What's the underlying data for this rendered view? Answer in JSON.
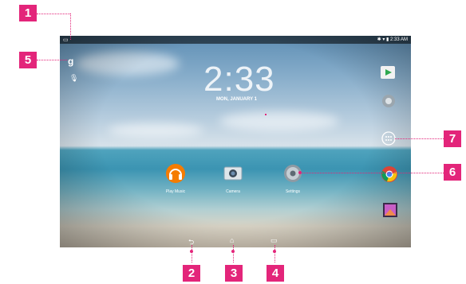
{
  "status_bar": {
    "time": "2:33 AM"
  },
  "lock": {
    "clock": "2:33",
    "date": "MON, JANUARY 1"
  },
  "apps": [
    {
      "label": "Play Music"
    },
    {
      "label": "Camera"
    },
    {
      "label": "Settings"
    }
  ],
  "callouts": [
    "1",
    "2",
    "3",
    "4",
    "5",
    "6",
    "7"
  ],
  "icons": {
    "search": "g-icon",
    "voice": "mic-icon",
    "play_store": "play-store-icon",
    "settings_right": "gear-icon",
    "app_drawer": "apps-grid-icon",
    "chrome": "chrome-icon",
    "gallery": "gallery-icon",
    "back": "back-icon",
    "home": "home-icon",
    "recents": "recents-icon"
  },
  "colors": {
    "callout": "#e3257a"
  }
}
